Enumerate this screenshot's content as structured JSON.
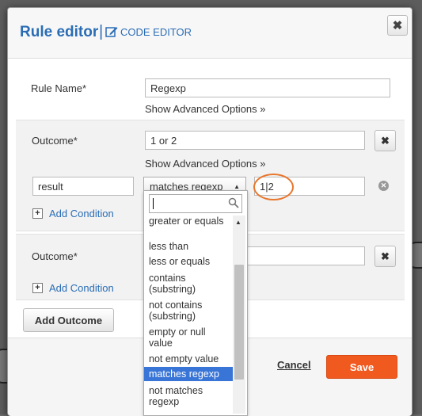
{
  "dialog": {
    "title": "Rule editor",
    "separator": "|",
    "code_editor_label": "CODE EDITOR",
    "close_label": "✖"
  },
  "rule": {
    "name_label": "Rule Name*",
    "name_value": "Regexp",
    "advanced_label": "Show Advanced Options »"
  },
  "outcomes": [
    {
      "label": "Outcome*",
      "value": "1 or 2",
      "advanced_label": "Show Advanced Options »",
      "condition": {
        "field": "result",
        "operator": "matches regexp",
        "value": "1|2"
      },
      "add_condition_label": "Add Condition"
    },
    {
      "label": "Outcome*",
      "value": "",
      "add_condition_label": "Add Condition"
    }
  ],
  "add_outcome_label": "Add Outcome",
  "footer": {
    "cancel_label": "Cancel",
    "save_label": "Save"
  },
  "operator_dropdown": {
    "search_value": "",
    "options": [
      "greater or equals",
      "less than",
      "less or equals",
      "contains (substring)",
      "not contains (substring)",
      "empty or null value",
      "not empty value",
      "matches regexp",
      "not matches regexp"
    ],
    "selected": "matches regexp"
  },
  "colors": {
    "accent": "#2a6db5",
    "save": "#f15a1f",
    "selected_option": "#3875d7",
    "highlight": "#e8772e"
  }
}
